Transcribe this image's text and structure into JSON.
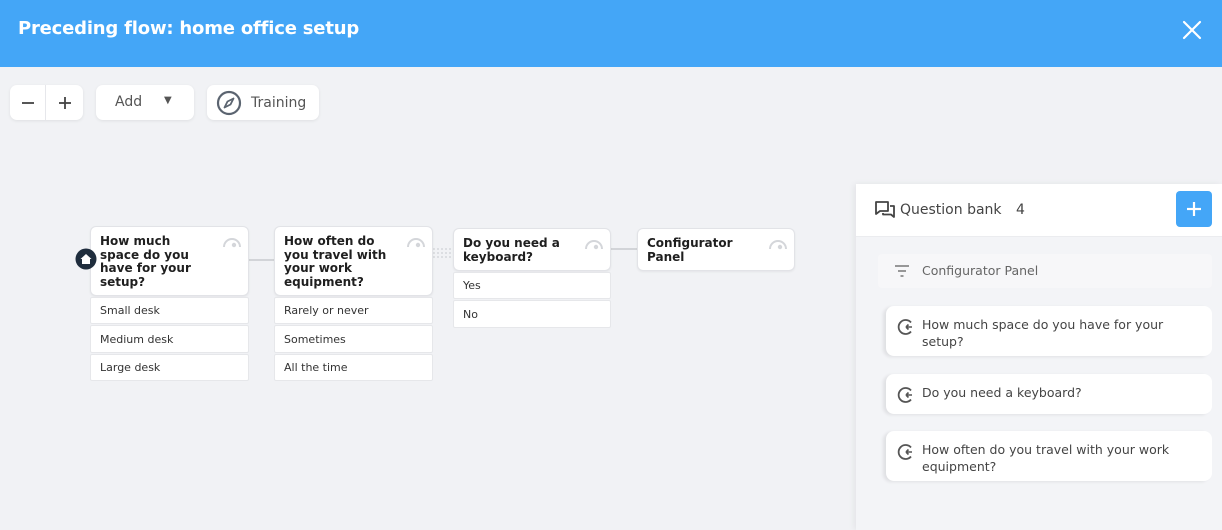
{
  "header": {
    "title": "Preceding flow: home office setup"
  },
  "toolbar": {
    "add_label": "Add",
    "training_label": "Training"
  },
  "nodes": [
    {
      "title": "How much space do you have for your setup?",
      "options": [
        "Small desk",
        "Medium desk",
        "Large desk"
      ]
    },
    {
      "title": "How often do you travel with your work equipment?",
      "options": [
        "Rarely or never",
        "Sometimes",
        "All the time"
      ]
    },
    {
      "title": "Do you need a keyboard?",
      "options": [
        "Yes",
        "No"
      ]
    },
    {
      "title": "Configurator Panel",
      "options": []
    }
  ],
  "question_bank": {
    "title": "Question bank",
    "count": "4",
    "filter_label": "Configurator Panel",
    "items": [
      "How much space do you have for your setup?",
      "Do you need a keyboard?",
      "How often do you travel with your work equipment?"
    ]
  },
  "colors": {
    "accent": "#44a6f7",
    "canvas": "#f1f2f5",
    "icon": "#5b6470"
  }
}
